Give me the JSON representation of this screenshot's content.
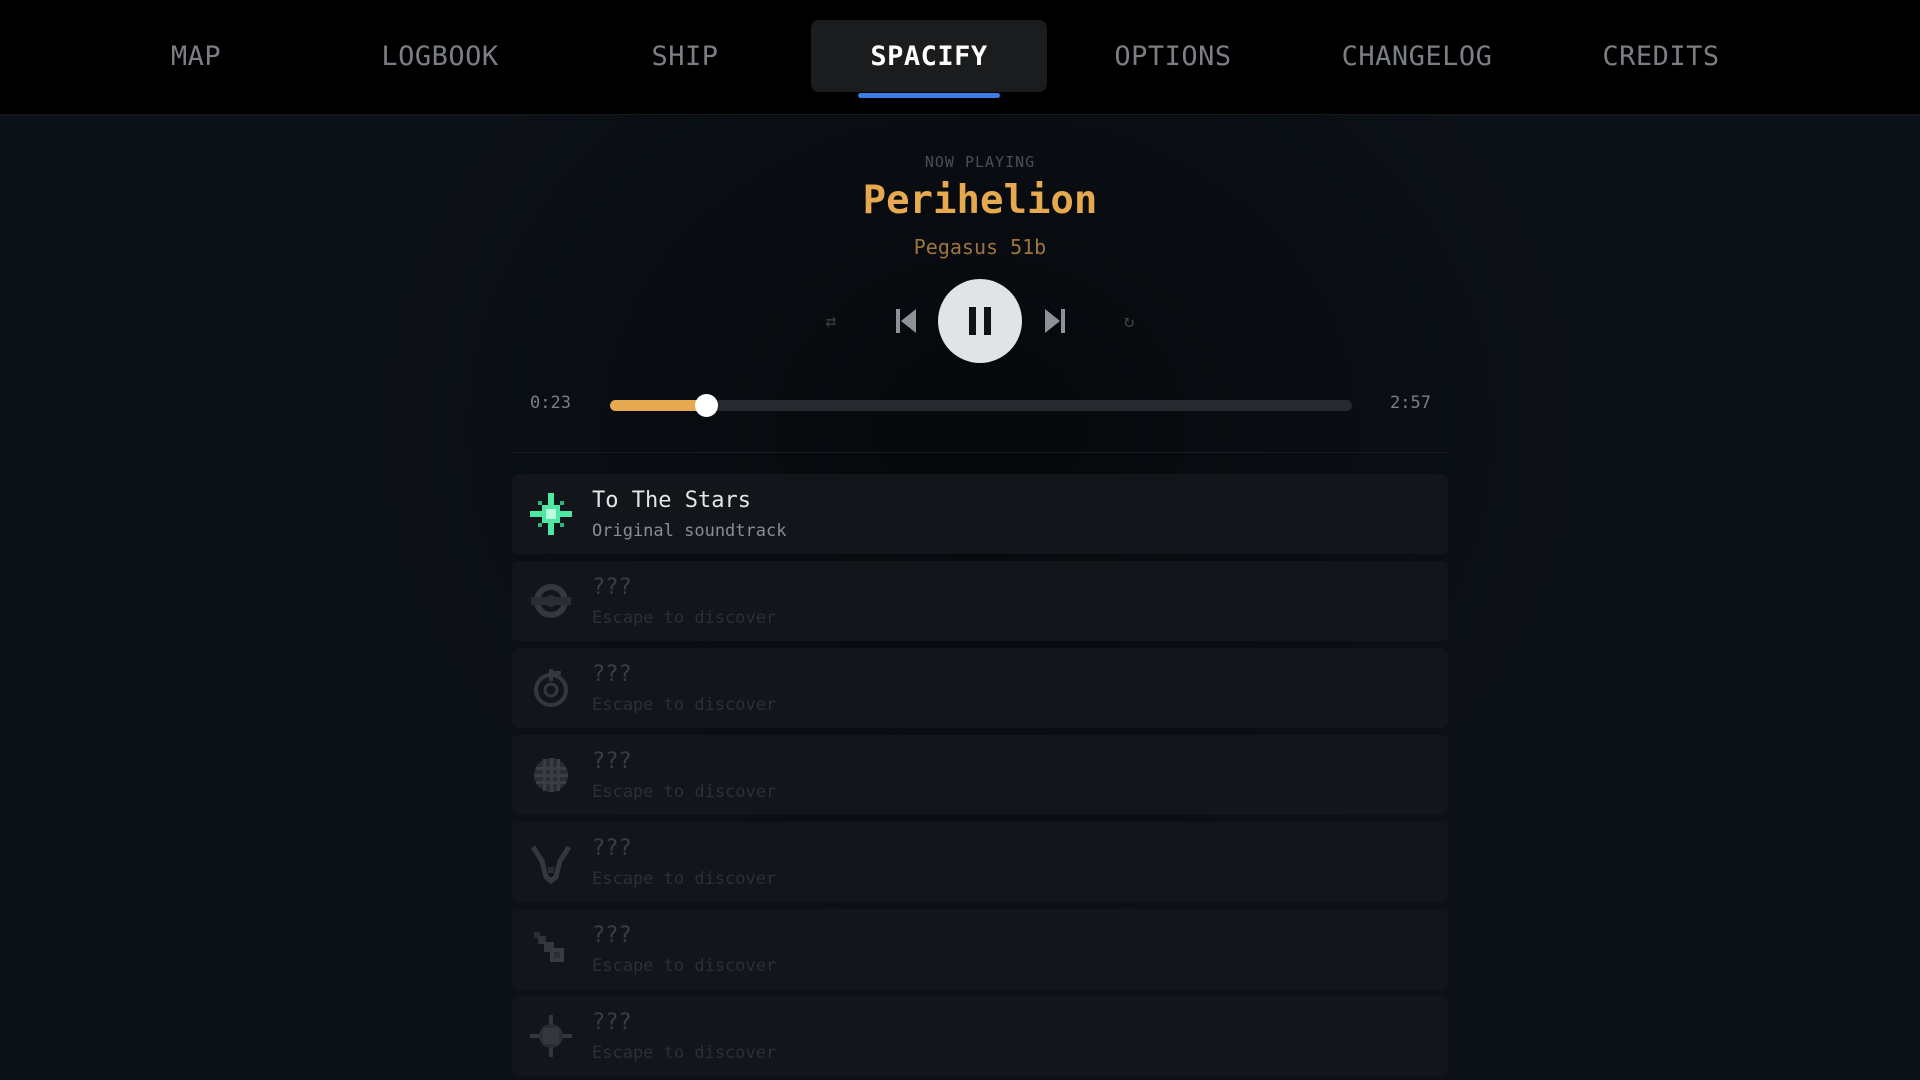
{
  "nav": {
    "tabs": [
      {
        "label": "MAP",
        "active": false
      },
      {
        "label": "LOGBOOK",
        "active": false
      },
      {
        "label": "SHIP",
        "active": false
      },
      {
        "label": "SPACIFY",
        "active": true
      },
      {
        "label": "OPTIONS",
        "active": false
      },
      {
        "label": "CHANGELOG",
        "active": false
      },
      {
        "label": "CREDITS",
        "active": false
      }
    ]
  },
  "player": {
    "now_playing_label": "NOW PLAYING",
    "title": "Perihelion",
    "subtitle": "Pegasus 51b",
    "elapsed": "0:23",
    "duration": "2:57",
    "progress_fraction": 0.13,
    "controls": {
      "shuffle_icon": "shuffle-icon",
      "prev_icon": "skip-previous-icon",
      "pause_icon": "pause-icon",
      "next_icon": "skip-next-icon",
      "repeat_icon": "repeat-icon",
      "shuffle_glyph": "⇄",
      "repeat_glyph": "↻"
    }
  },
  "colors": {
    "accent": "#e6a94f",
    "tab_indicator": "#3d7ce6",
    "unlocked_icon": "#4ee7a4"
  },
  "songs": [
    {
      "title": "To The Stars",
      "subtitle": "Original soundtrack",
      "icon": "sparkle-star-icon",
      "locked": false
    },
    {
      "title": "???",
      "subtitle": "Escape to discover",
      "icon": "ring-planet-icon",
      "locked": true
    },
    {
      "title": "???",
      "subtitle": "Escape to discover",
      "icon": "orbit-ring-icon",
      "locked": true
    },
    {
      "title": "???",
      "subtitle": "Escape to discover",
      "icon": "grid-globe-icon",
      "locked": true
    },
    {
      "title": "???",
      "subtitle": "Escape to discover",
      "icon": "v-shape-icon",
      "locked": true
    },
    {
      "title": "???",
      "subtitle": "Escape to discover",
      "icon": "comet-icon",
      "locked": true
    },
    {
      "title": "???",
      "subtitle": "Escape to discover",
      "icon": "spiky-star-icon",
      "locked": true
    }
  ]
}
